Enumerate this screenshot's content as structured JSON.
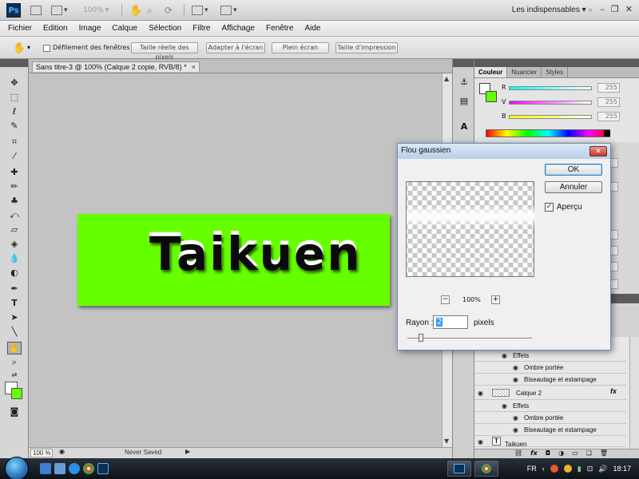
{
  "appbar": {
    "logo": "Ps",
    "zoom": "100%",
    "workspace": "Les indispensables",
    "icons": [
      "bridge-icon",
      "screen-mode-icon",
      "hand-icon",
      "zoom-icon",
      "rotate-icon",
      "arrange-icon",
      "screen-icon"
    ]
  },
  "menu": [
    "Fichier",
    "Edition",
    "Image",
    "Calque",
    "Sélection",
    "Filtre",
    "Affichage",
    "Fenêtre",
    "Aide"
  ],
  "options": {
    "checkbox_label": "Défilement des fenêtres",
    "buttons": [
      "Taille réelle des pixels",
      "Adapter à l'écran",
      "Plein écran",
      "Taille d'impression"
    ]
  },
  "document": {
    "tab_title": "Sans titre-3 @ 100% (Calque 2 copie, RVB/8) *",
    "tab_close": "×",
    "canvas_text": "Taikuen",
    "canvas_color": "#66ff00"
  },
  "status": {
    "zoom": "100 %",
    "text": "Never Saved"
  },
  "color_panel": {
    "tabs": [
      "Couleur",
      "Nuancier",
      "Styles"
    ],
    "sliders": [
      {
        "label": "R",
        "value": "255"
      },
      {
        "label": "V",
        "value": "255"
      },
      {
        "label": "B",
        "value": "255"
      }
    ]
  },
  "layers": [
    {
      "type": "fx-group",
      "label": "Effets"
    },
    {
      "type": "effect",
      "label": "Ombre portée"
    },
    {
      "type": "effect",
      "label": "Biseautage et estampage"
    },
    {
      "type": "layer",
      "label": "Calque 2",
      "fx": "fx"
    },
    {
      "type": "fx-group",
      "label": "Effets"
    },
    {
      "type": "effect",
      "label": "Ombre portée"
    },
    {
      "type": "effect",
      "label": "Biseautage et estampage"
    },
    {
      "type": "text-layer",
      "label": "Taikuen"
    }
  ],
  "dialog": {
    "title": "Flou gaussien",
    "ok": "OK",
    "cancel": "Annuler",
    "preview_label": "Aperçu",
    "preview_checked": "✓",
    "zoom": "100%",
    "zoom_minus": "−",
    "zoom_plus": "+",
    "radius_label": "Rayon :",
    "radius_value": "2",
    "radius_unit": "pixels",
    "close": "✕"
  },
  "taskbar": {
    "lang": "FR",
    "time": "18:17"
  }
}
